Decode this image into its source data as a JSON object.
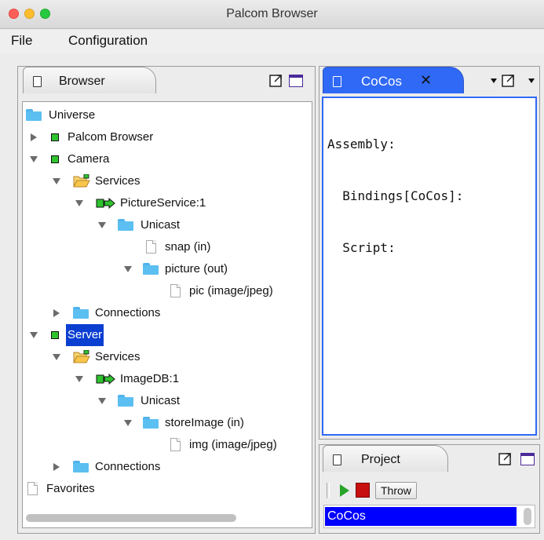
{
  "window": {
    "title": "Palcom Browser"
  },
  "menu": {
    "file": "File",
    "configuration": "Configuration"
  },
  "browser_panel": {
    "tab_label": "Browser",
    "tree": [
      {
        "label": "Universe"
      },
      {
        "label": "Palcom Browser"
      },
      {
        "label": "Camera"
      },
      {
        "label": "Services"
      },
      {
        "label": "PictureService:1"
      },
      {
        "label": "Unicast"
      },
      {
        "label": "snap (in)"
      },
      {
        "label": "picture (out)"
      },
      {
        "label": "pic (image/jpeg)"
      },
      {
        "label": "Connections"
      },
      {
        "label": "Server"
      },
      {
        "label": "Services"
      },
      {
        "label": "ImageDB:1"
      },
      {
        "label": "Unicast"
      },
      {
        "label": "storeImage (in)"
      },
      {
        "label": "img (image/jpeg)"
      },
      {
        "label": "Connections"
      },
      {
        "label": "Favorites"
      }
    ]
  },
  "cocos_panel": {
    "tab_label": "CoCos",
    "close_glyph": "✕",
    "editor_lines": [
      "Assembly:",
      "  Bindings[CoCos]:",
      "  Script:"
    ]
  },
  "project_panel": {
    "tab_label": "Project",
    "throw_label": "Throw",
    "list_items": [
      "CoCos"
    ]
  },
  "colors": {
    "selection": "#0a3fd1",
    "active_tab": "#2f69f5",
    "folder": "#5cbff1"
  }
}
